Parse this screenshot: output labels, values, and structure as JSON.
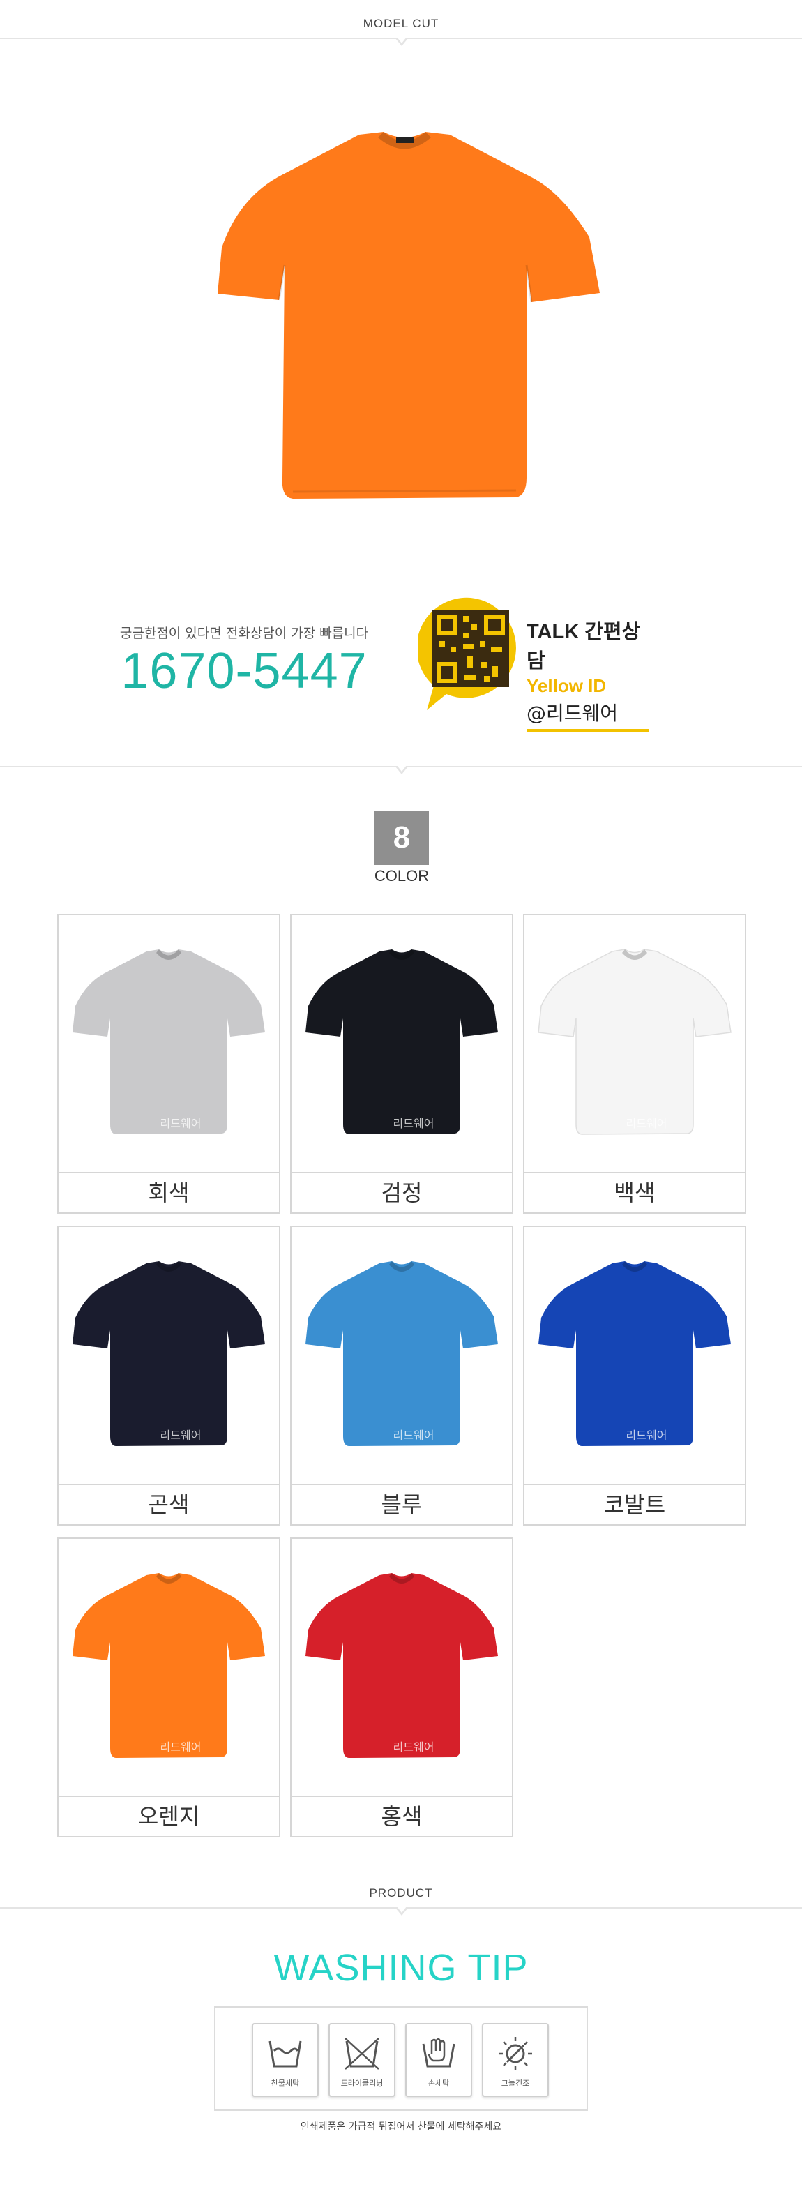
{
  "sections": {
    "model_cut": "MODEL CUT",
    "product": "PRODUCT"
  },
  "contact": {
    "question": "궁금한점이 있다면 전화상담이 가장 빠릅니다",
    "phone": "1670-5447",
    "talk_title": "TALK 간편상담",
    "yellow_id": "Yellow ID",
    "account": "@리드웨어"
  },
  "colors": {
    "count": "8",
    "label": "COLOR",
    "watermark": "리드웨어",
    "items": [
      {
        "name": "회색",
        "hex": "#c9c9cb"
      },
      {
        "name": "검정",
        "hex": "#16181f"
      },
      {
        "name": "백색",
        "hex": "#f5f5f5"
      },
      {
        "name": "곤색",
        "hex": "#1a1c2e"
      },
      {
        "name": "블루",
        "hex": "#3a8fd1"
      },
      {
        "name": "코발트",
        "hex": "#1545b5"
      },
      {
        "name": "오렌지",
        "hex": "#ff7a1a"
      },
      {
        "name": "홍색",
        "hex": "#d6202a"
      }
    ]
  },
  "hero": {
    "color": "#ff7a1a"
  },
  "washing": {
    "title": "WASHING TIP",
    "items": [
      {
        "label": "찬물세탁",
        "icon": "cold-water-wash-icon"
      },
      {
        "label": "드라이클리닝",
        "icon": "dry-clean-icon"
      },
      {
        "label": "손세탁",
        "icon": "hand-wash-icon"
      },
      {
        "label": "그늘건조",
        "icon": "shade-dry-icon"
      }
    ],
    "note": "인쇄제품은 가급적 뒤집어서 찬물에 세탁해주세요"
  }
}
